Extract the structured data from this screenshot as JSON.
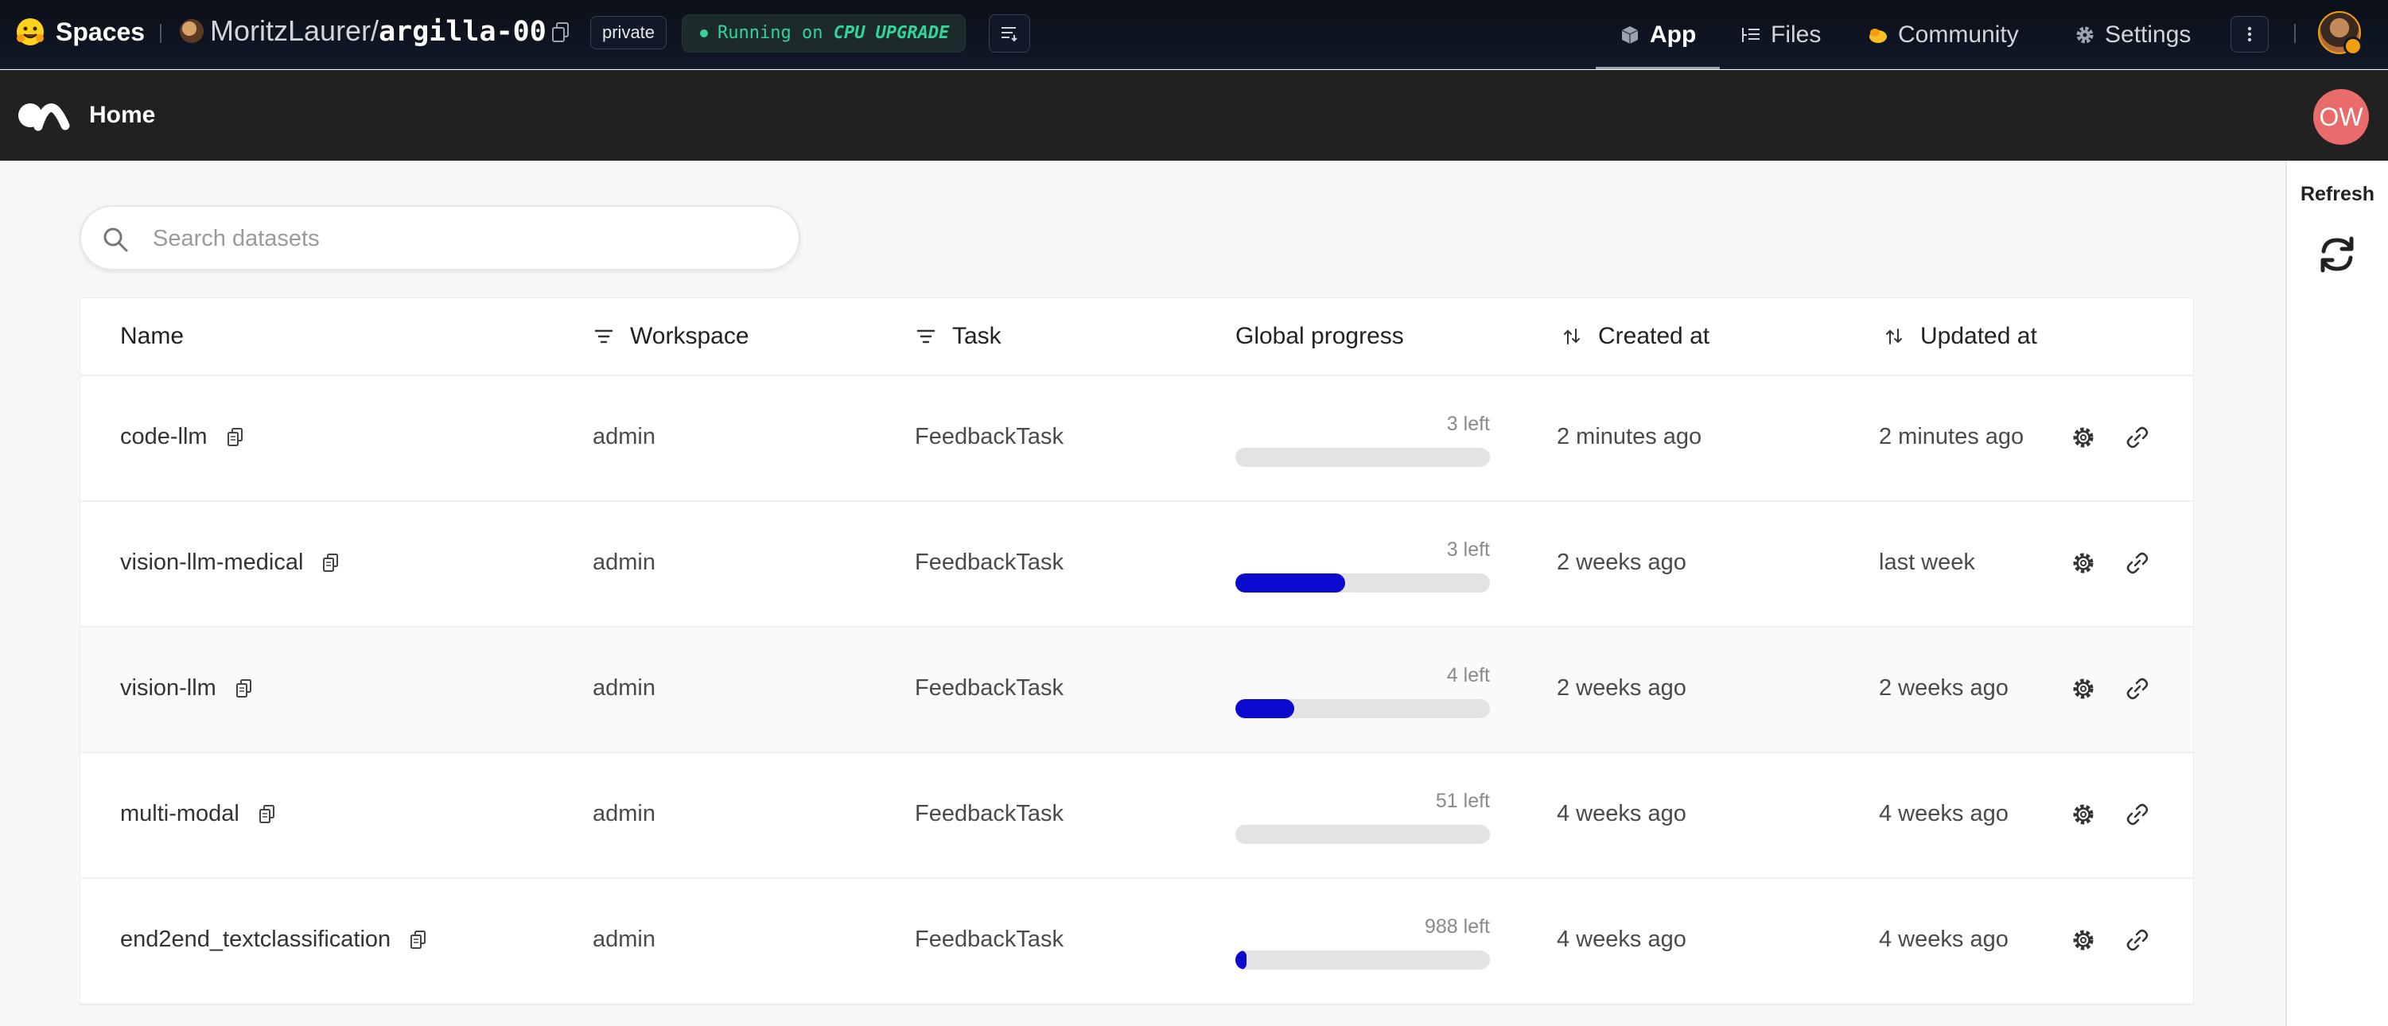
{
  "topbar": {
    "brand": "Spaces",
    "owner": "MoritzLaurer/",
    "repo": "argilla-00",
    "visibility": "private",
    "status_prefix": "Running on",
    "status_hardware": "CPU UPGRADE",
    "nav": [
      {
        "label": "App",
        "icon": "cube-icon"
      },
      {
        "label": "Files",
        "icon": "files-icon"
      },
      {
        "label": "Community",
        "icon": "community-icon"
      },
      {
        "label": "Settings",
        "icon": "gear-icon"
      }
    ]
  },
  "header": {
    "title": "Home",
    "user_initials": "OW"
  },
  "sidebar": {
    "refresh_label": "Refresh"
  },
  "search": {
    "placeholder": "Search datasets",
    "value": ""
  },
  "table": {
    "columns": [
      "Name",
      "Workspace",
      "Task",
      "Global progress",
      "Created at",
      "Updated at"
    ],
    "rows": [
      {
        "name": "code-llm",
        "workspace": "admin",
        "task": "FeedbackTask",
        "progress_left": "3 left",
        "progress_fraction": 0.0,
        "created": "2 minutes ago",
        "updated": "2 minutes ago"
      },
      {
        "name": "vision-llm-medical",
        "workspace": "admin",
        "task": "FeedbackTask",
        "progress_left": "3 left",
        "progress_fraction": 0.43,
        "created": "2 weeks ago",
        "updated": "last week"
      },
      {
        "name": "vision-llm",
        "workspace": "admin",
        "task": "FeedbackTask",
        "progress_left": "4 left",
        "progress_fraction": 0.23,
        "created": "2 weeks ago",
        "updated": "2 weeks ago"
      },
      {
        "name": "multi-modal",
        "workspace": "admin",
        "task": "FeedbackTask",
        "progress_left": "51 left",
        "progress_fraction": 0.0,
        "created": "4 weeks ago",
        "updated": "4 weeks ago"
      },
      {
        "name": "end2end_textclassification",
        "workspace": "admin",
        "task": "FeedbackTask",
        "progress_left": "988 left",
        "progress_fraction": 0.03,
        "created": "4 weeks ago",
        "updated": "4 weeks ago"
      }
    ]
  },
  "colors": {
    "progress_fill": "#0b0bd0",
    "progress_track": "#e3e3e3",
    "avatar": "#e96b6b",
    "status_green": "#34d399"
  }
}
